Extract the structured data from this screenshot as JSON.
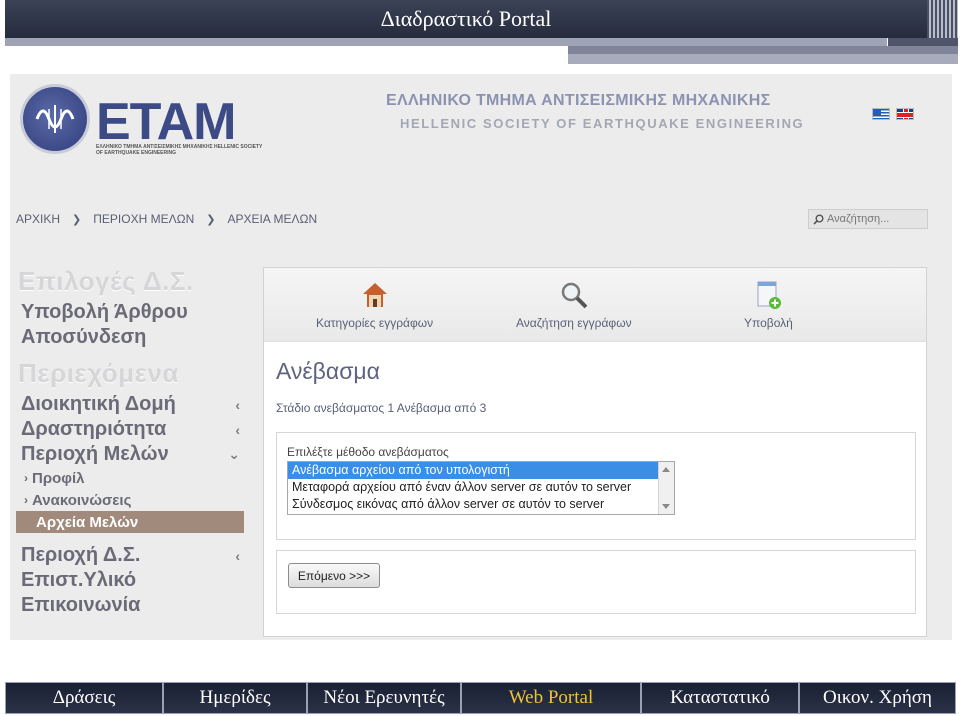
{
  "slide": {
    "title": "Διαδραστικό Portal"
  },
  "site": {
    "logo_text": "ETAM",
    "logo_sub": "ΕΛΛΗΝΙΚΟ ΤΜΗΜΑ ΑΝΤΙΣΕΙΣΜΙΚΗΣ ΜΗΧΑΝΙΚΗΣ HELLENIC SOCIETY OF EARTHQUAKE ENGINEERING",
    "org_name_gr": "ΕΛΛΗΝΙΚΟ ΤΜΗΜΑ ΑΝΤΙΣΕΙΣΜΙΚΗΣ ΜΗΧΑΝΙΚΗΣ",
    "org_name_en": "HELLENIC SOCIETY OF EARTHQUAKE ENGINEERING",
    "accent": "#3c4a86"
  },
  "breadcrumb": [
    "ΑΡΧΙΚΗ",
    "ΠΕΡΙΟΧΗ ΜΕΛΩΝ",
    "ΑΡΧΕΙΑ ΜΕΛΩΝ"
  ],
  "search": {
    "placeholder": "Αναζήτηση..."
  },
  "sidebar": {
    "board_heading": "Επιλογές Δ.Σ.",
    "board_items": [
      "Υποβολή Άρθρου",
      "Αποσύνδεση"
    ],
    "content_heading": "Περιεχόμενα",
    "content_items": [
      {
        "label": "Διοικητική Δομή",
        "chevron": "‹"
      },
      {
        "label": "Δραστηριότητα",
        "chevron": "‹"
      },
      {
        "label": "Περιοχή Μελών",
        "chevron": "⌄"
      }
    ],
    "sub_items": [
      {
        "label": "Προφίλ",
        "arrow": "›"
      },
      {
        "label": "Ανακοινώσεις",
        "arrow": "›"
      },
      {
        "label": "Αρχεία Μελών",
        "arrow": ""
      }
    ],
    "lower_items": [
      {
        "label": "Περιοχή Δ.Σ.",
        "chevron": "‹"
      },
      {
        "label": "Επιστ.Υλικό",
        "chevron": ""
      },
      {
        "label": "Επικοινωνία",
        "chevron": ""
      }
    ],
    "active_color": "#a18a7c"
  },
  "toolbar": {
    "categories": "Κατηγορίες εγγράφων",
    "search_docs": "Αναζήτηση εγγράφων",
    "submit": "Υποβολή"
  },
  "upload": {
    "title": "Ανέβασμα",
    "step": "Στάδιο ανεβάσματος 1 Ανέβασμα από 3",
    "method_label": "Επιλέξτε μέθοδο ανεβάσματος",
    "options": [
      "Ανέβασμα αρχείου από τον υπολογιστή",
      "Μεταφορά αρχείου από έναν άλλον server σε αυτόν το server",
      "Σύνδεσμος εικόνας από άλλον server σε αυτόν το server"
    ],
    "next_label": "Επόμενο >>>",
    "selected_color": "#3a8ee6"
  },
  "bottom_nav": {
    "items": [
      "Δράσεις",
      "Ημερίδες",
      "Νέοι Ερευνητές",
      "Web Portal",
      "Καταστατικό",
      "Οικον. Χρήση"
    ],
    "active_color": "#f0c23a"
  }
}
